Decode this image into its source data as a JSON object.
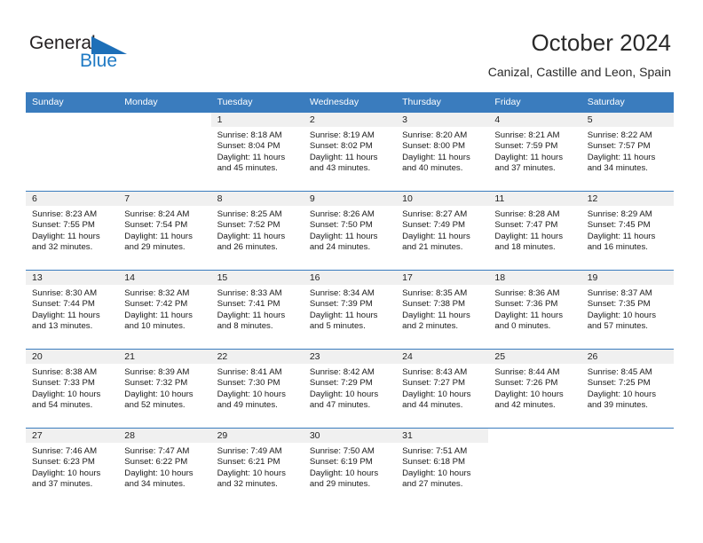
{
  "brand": {
    "name_part1": "General",
    "name_part2": "Blue",
    "logo_icon": "triangle-logo-icon"
  },
  "header": {
    "title": "October 2024",
    "subtitle": "Canizal, Castille and Leon, Spain"
  },
  "calendar": {
    "weekday_headers": [
      "Sunday",
      "Monday",
      "Tuesday",
      "Wednesday",
      "Thursday",
      "Friday",
      "Saturday"
    ],
    "accent_color": "#3a7cbe",
    "daynum_strip_color": "#f0f0f0",
    "weeks": [
      [
        {
          "day": "",
          "sunrise": "",
          "sunset": "",
          "daylight_line1": "",
          "daylight_line2": ""
        },
        {
          "day": "",
          "sunrise": "",
          "sunset": "",
          "daylight_line1": "",
          "daylight_line2": ""
        },
        {
          "day": "1",
          "sunrise": "Sunrise: 8:18 AM",
          "sunset": "Sunset: 8:04 PM",
          "daylight_line1": "Daylight: 11 hours",
          "daylight_line2": "and 45 minutes."
        },
        {
          "day": "2",
          "sunrise": "Sunrise: 8:19 AM",
          "sunset": "Sunset: 8:02 PM",
          "daylight_line1": "Daylight: 11 hours",
          "daylight_line2": "and 43 minutes."
        },
        {
          "day": "3",
          "sunrise": "Sunrise: 8:20 AM",
          "sunset": "Sunset: 8:00 PM",
          "daylight_line1": "Daylight: 11 hours",
          "daylight_line2": "and 40 minutes."
        },
        {
          "day": "4",
          "sunrise": "Sunrise: 8:21 AM",
          "sunset": "Sunset: 7:59 PM",
          "daylight_line1": "Daylight: 11 hours",
          "daylight_line2": "and 37 minutes."
        },
        {
          "day": "5",
          "sunrise": "Sunrise: 8:22 AM",
          "sunset": "Sunset: 7:57 PM",
          "daylight_line1": "Daylight: 11 hours",
          "daylight_line2": "and 34 minutes."
        }
      ],
      [
        {
          "day": "6",
          "sunrise": "Sunrise: 8:23 AM",
          "sunset": "Sunset: 7:55 PM",
          "daylight_line1": "Daylight: 11 hours",
          "daylight_line2": "and 32 minutes."
        },
        {
          "day": "7",
          "sunrise": "Sunrise: 8:24 AM",
          "sunset": "Sunset: 7:54 PM",
          "daylight_line1": "Daylight: 11 hours",
          "daylight_line2": "and 29 minutes."
        },
        {
          "day": "8",
          "sunrise": "Sunrise: 8:25 AM",
          "sunset": "Sunset: 7:52 PM",
          "daylight_line1": "Daylight: 11 hours",
          "daylight_line2": "and 26 minutes."
        },
        {
          "day": "9",
          "sunrise": "Sunrise: 8:26 AM",
          "sunset": "Sunset: 7:50 PM",
          "daylight_line1": "Daylight: 11 hours",
          "daylight_line2": "and 24 minutes."
        },
        {
          "day": "10",
          "sunrise": "Sunrise: 8:27 AM",
          "sunset": "Sunset: 7:49 PM",
          "daylight_line1": "Daylight: 11 hours",
          "daylight_line2": "and 21 minutes."
        },
        {
          "day": "11",
          "sunrise": "Sunrise: 8:28 AM",
          "sunset": "Sunset: 7:47 PM",
          "daylight_line1": "Daylight: 11 hours",
          "daylight_line2": "and 18 minutes."
        },
        {
          "day": "12",
          "sunrise": "Sunrise: 8:29 AM",
          "sunset": "Sunset: 7:45 PM",
          "daylight_line1": "Daylight: 11 hours",
          "daylight_line2": "and 16 minutes."
        }
      ],
      [
        {
          "day": "13",
          "sunrise": "Sunrise: 8:30 AM",
          "sunset": "Sunset: 7:44 PM",
          "daylight_line1": "Daylight: 11 hours",
          "daylight_line2": "and 13 minutes."
        },
        {
          "day": "14",
          "sunrise": "Sunrise: 8:32 AM",
          "sunset": "Sunset: 7:42 PM",
          "daylight_line1": "Daylight: 11 hours",
          "daylight_line2": "and 10 minutes."
        },
        {
          "day": "15",
          "sunrise": "Sunrise: 8:33 AM",
          "sunset": "Sunset: 7:41 PM",
          "daylight_line1": "Daylight: 11 hours",
          "daylight_line2": "and 8 minutes."
        },
        {
          "day": "16",
          "sunrise": "Sunrise: 8:34 AM",
          "sunset": "Sunset: 7:39 PM",
          "daylight_line1": "Daylight: 11 hours",
          "daylight_line2": "and 5 minutes."
        },
        {
          "day": "17",
          "sunrise": "Sunrise: 8:35 AM",
          "sunset": "Sunset: 7:38 PM",
          "daylight_line1": "Daylight: 11 hours",
          "daylight_line2": "and 2 minutes."
        },
        {
          "day": "18",
          "sunrise": "Sunrise: 8:36 AM",
          "sunset": "Sunset: 7:36 PM",
          "daylight_line1": "Daylight: 11 hours",
          "daylight_line2": "and 0 minutes."
        },
        {
          "day": "19",
          "sunrise": "Sunrise: 8:37 AM",
          "sunset": "Sunset: 7:35 PM",
          "daylight_line1": "Daylight: 10 hours",
          "daylight_line2": "and 57 minutes."
        }
      ],
      [
        {
          "day": "20",
          "sunrise": "Sunrise: 8:38 AM",
          "sunset": "Sunset: 7:33 PM",
          "daylight_line1": "Daylight: 10 hours",
          "daylight_line2": "and 54 minutes."
        },
        {
          "day": "21",
          "sunrise": "Sunrise: 8:39 AM",
          "sunset": "Sunset: 7:32 PM",
          "daylight_line1": "Daylight: 10 hours",
          "daylight_line2": "and 52 minutes."
        },
        {
          "day": "22",
          "sunrise": "Sunrise: 8:41 AM",
          "sunset": "Sunset: 7:30 PM",
          "daylight_line1": "Daylight: 10 hours",
          "daylight_line2": "and 49 minutes."
        },
        {
          "day": "23",
          "sunrise": "Sunrise: 8:42 AM",
          "sunset": "Sunset: 7:29 PM",
          "daylight_line1": "Daylight: 10 hours",
          "daylight_line2": "and 47 minutes."
        },
        {
          "day": "24",
          "sunrise": "Sunrise: 8:43 AM",
          "sunset": "Sunset: 7:27 PM",
          "daylight_line1": "Daylight: 10 hours",
          "daylight_line2": "and 44 minutes."
        },
        {
          "day": "25",
          "sunrise": "Sunrise: 8:44 AM",
          "sunset": "Sunset: 7:26 PM",
          "daylight_line1": "Daylight: 10 hours",
          "daylight_line2": "and 42 minutes."
        },
        {
          "day": "26",
          "sunrise": "Sunrise: 8:45 AM",
          "sunset": "Sunset: 7:25 PM",
          "daylight_line1": "Daylight: 10 hours",
          "daylight_line2": "and 39 minutes."
        }
      ],
      [
        {
          "day": "27",
          "sunrise": "Sunrise: 7:46 AM",
          "sunset": "Sunset: 6:23 PM",
          "daylight_line1": "Daylight: 10 hours",
          "daylight_line2": "and 37 minutes."
        },
        {
          "day": "28",
          "sunrise": "Sunrise: 7:47 AM",
          "sunset": "Sunset: 6:22 PM",
          "daylight_line1": "Daylight: 10 hours",
          "daylight_line2": "and 34 minutes."
        },
        {
          "day": "29",
          "sunrise": "Sunrise: 7:49 AM",
          "sunset": "Sunset: 6:21 PM",
          "daylight_line1": "Daylight: 10 hours",
          "daylight_line2": "and 32 minutes."
        },
        {
          "day": "30",
          "sunrise": "Sunrise: 7:50 AM",
          "sunset": "Sunset: 6:19 PM",
          "daylight_line1": "Daylight: 10 hours",
          "daylight_line2": "and 29 minutes."
        },
        {
          "day": "31",
          "sunrise": "Sunrise: 7:51 AM",
          "sunset": "Sunset: 6:18 PM",
          "daylight_line1": "Daylight: 10 hours",
          "daylight_line2": "and 27 minutes."
        },
        {
          "day": "",
          "sunrise": "",
          "sunset": "",
          "daylight_line1": "",
          "daylight_line2": ""
        },
        {
          "day": "",
          "sunrise": "",
          "sunset": "",
          "daylight_line1": "",
          "daylight_line2": ""
        }
      ]
    ]
  }
}
